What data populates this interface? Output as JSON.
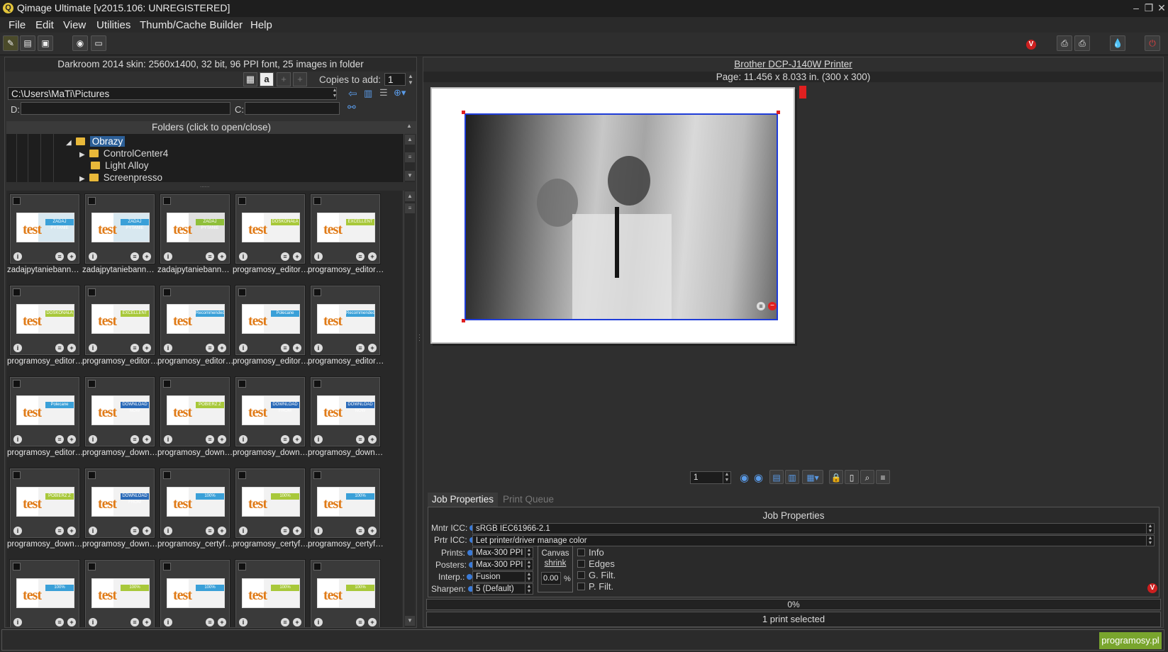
{
  "window": {
    "title": "Qimage Ultimate [v2015.106: UNREGISTERED]"
  },
  "menu": [
    "File",
    "Edit",
    "View",
    "Utilities",
    "Thumb/Cache Builder",
    "Help"
  ],
  "left": {
    "info": "Darkroom 2014 skin: 2560x1400, 32 bit, 96 PPI font, 25 images in folder",
    "copies_label": "Copies to add:",
    "copies_value": "1",
    "path": "C:\\Users\\MaTi\\Pictures",
    "d_label": "D:",
    "c_label": "C:",
    "folders_header": "Folders (click to open/close)",
    "folders": [
      {
        "name": "Obrazy",
        "expanded": true,
        "selected": true
      },
      {
        "name": "ControlCenter4"
      },
      {
        "name": "Light Alloy"
      },
      {
        "name": "Screenpresso"
      }
    ],
    "thumbnails": [
      {
        "name": "zadajpytaniebanner0...",
        "band": "ZADAJ PYTANIE"
      },
      {
        "name": "zadajpytaniebanner0...",
        "band": "ZADAJ PYTANIE"
      },
      {
        "name": "zadajpytaniebanner0...",
        "band": "ZADAJ PYTANIE"
      },
      {
        "name": "programosy_editorsr...",
        "band": "DOSKONAŁA"
      },
      {
        "name": "programosy_editorsr...",
        "band": "EXCELLENT"
      },
      {
        "name": "programosy_editorsr...",
        "band": "DOSKONAŁA"
      },
      {
        "name": "programosy_editorsr...",
        "band": "EXCELLENT"
      },
      {
        "name": "programosy_editors...",
        "band": "Recommended"
      },
      {
        "name": "programosy_editors...",
        "band": "Polecane"
      },
      {
        "name": "programosy_editors...",
        "band": "Recommended"
      },
      {
        "name": "programosy_editors...",
        "band": "Polecane"
      },
      {
        "name": "programosy_downlo...",
        "band": "DOWNLOAD NOW"
      },
      {
        "name": "programosy_downlo...",
        "band": "POBIERZ Z"
      },
      {
        "name": "programosy_downlo...",
        "band": "DOWNLOAD FROM"
      },
      {
        "name": "programosy_downlo...",
        "band": "DOWNLOAD NOW"
      },
      {
        "name": "programosy_downlo...",
        "band": "POBIERZ Z"
      },
      {
        "name": "programosy_downlo...",
        "band": "DOWNLOAD FROM"
      },
      {
        "name": "programosy_certyfik...",
        "band": "100%"
      },
      {
        "name": "programosy_certyfik...",
        "band": "100%"
      },
      {
        "name": "programosy_certyfik...",
        "band": "100%"
      },
      {
        "name": "",
        "band": "100%"
      },
      {
        "name": "",
        "band": "100%"
      },
      {
        "name": "",
        "band": "100%"
      },
      {
        "name": "",
        "band": "100%"
      },
      {
        "name": "",
        "band": "100%"
      }
    ],
    "thumb_word": "test"
  },
  "right": {
    "printer": "Brother DCP-J140W Printer",
    "page": "Page: 11.456 x 8.033 in.  (300 x 300)",
    "page_field": "1",
    "tabs": [
      "Job Properties",
      "Print Queue"
    ],
    "job_title": "Job Properties",
    "mntr_label": "Mntr ICC:",
    "mntr_value": "sRGB IEC61966-2.1",
    "prtr_label": "Prtr ICC:",
    "prtr_value": "Let printer/driver manage color",
    "prints_label": "Prints:",
    "prints_value": "Max-300 PPI",
    "posters_label": "Posters:",
    "posters_value": "Max-300 PPI",
    "interp_label": "Interp.:",
    "interp_value": "Fusion",
    "sharpen_label": "Sharpen:",
    "sharpen_value": "5 (Default)",
    "canvas_label": "Canvas",
    "shrink_label": "shrink",
    "shrink_value": "0.00",
    "percent": "%",
    "checks": [
      "Info",
      "Edges",
      "G. Filt.",
      "P. Filt."
    ],
    "progress": "0%",
    "selected": "1 print selected"
  },
  "status": {
    "brand": "programosy.pl"
  },
  "colors": {
    "accent": "#1e3cd8",
    "bg": "#2b2b2b",
    "brand": "#79a52d"
  }
}
